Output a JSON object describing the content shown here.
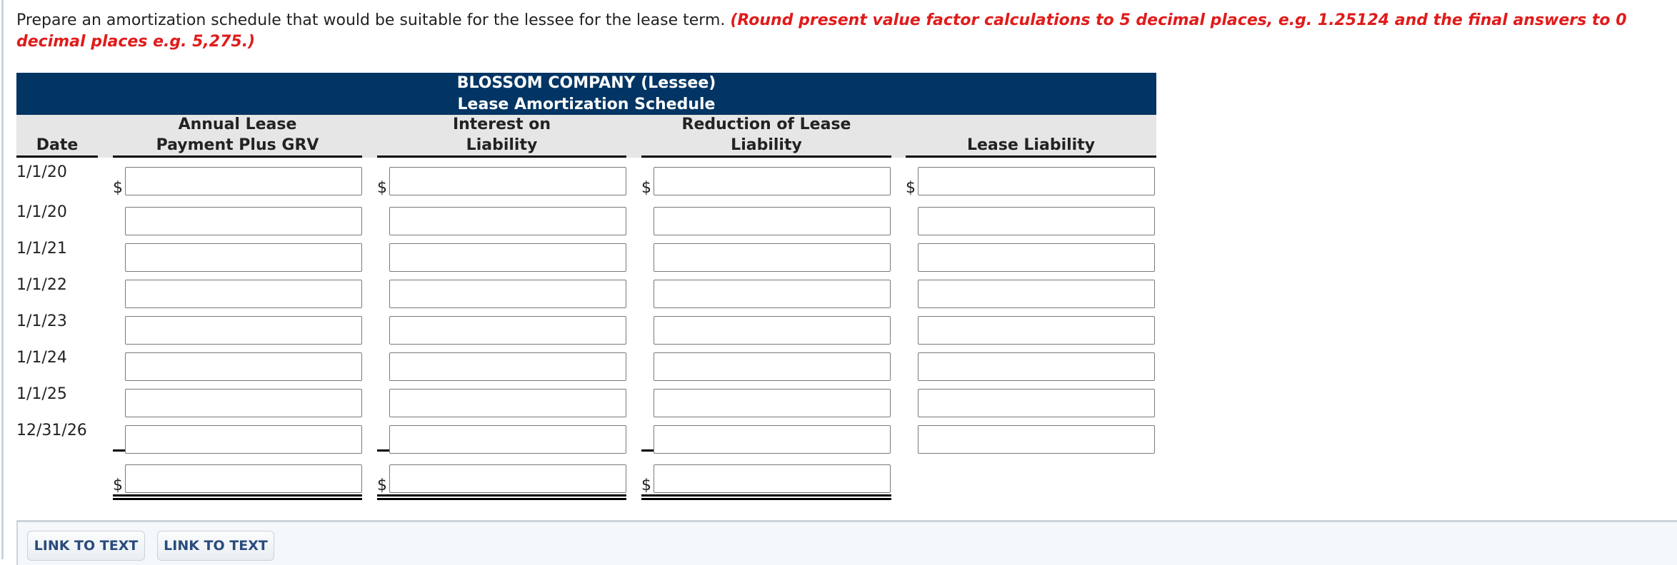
{
  "instructions": {
    "text": "Prepare an amortization schedule that would be suitable for the lessee for the lease term.",
    "note": "(Round present value factor calculations to 5 decimal places, e.g. 1.25124 and the final answers to 0 decimal places e.g. 5,275.)"
  },
  "schedule": {
    "company": "BLOSSOM COMPANY (Lessee)",
    "title": "Lease Amortization Schedule",
    "headers": {
      "date": "Date",
      "col1_line1": "Annual Lease",
      "col1_line2": "Payment Plus GRV",
      "col2_line1": "Interest on",
      "col2_line2": "Liability",
      "col3_line1": "Reduction of Lease",
      "col3_line2": "Liability",
      "col4": "Lease Liability"
    },
    "currency_symbol": "$",
    "rows": [
      {
        "date": "1/1/20",
        "payment": "",
        "interest": "",
        "reduction": "",
        "liability": ""
      },
      {
        "date": "1/1/20",
        "payment": "",
        "interest": "",
        "reduction": "",
        "liability": ""
      },
      {
        "date": "1/1/21",
        "payment": "",
        "interest": "",
        "reduction": "",
        "liability": ""
      },
      {
        "date": "1/1/22",
        "payment": "",
        "interest": "",
        "reduction": "",
        "liability": ""
      },
      {
        "date": "1/1/23",
        "payment": "",
        "interest": "",
        "reduction": "",
        "liability": ""
      },
      {
        "date": "1/1/24",
        "payment": "",
        "interest": "",
        "reduction": "",
        "liability": ""
      },
      {
        "date": "1/1/25",
        "payment": "",
        "interest": "",
        "reduction": "",
        "liability": ""
      },
      {
        "date": "12/31/26",
        "payment": "",
        "interest": "",
        "reduction": "",
        "liability": ""
      }
    ],
    "totals": {
      "payment": "",
      "interest": "",
      "reduction": ""
    }
  },
  "footer": {
    "buttons": [
      "LINK TO TEXT",
      "LINK TO TEXT"
    ]
  }
}
